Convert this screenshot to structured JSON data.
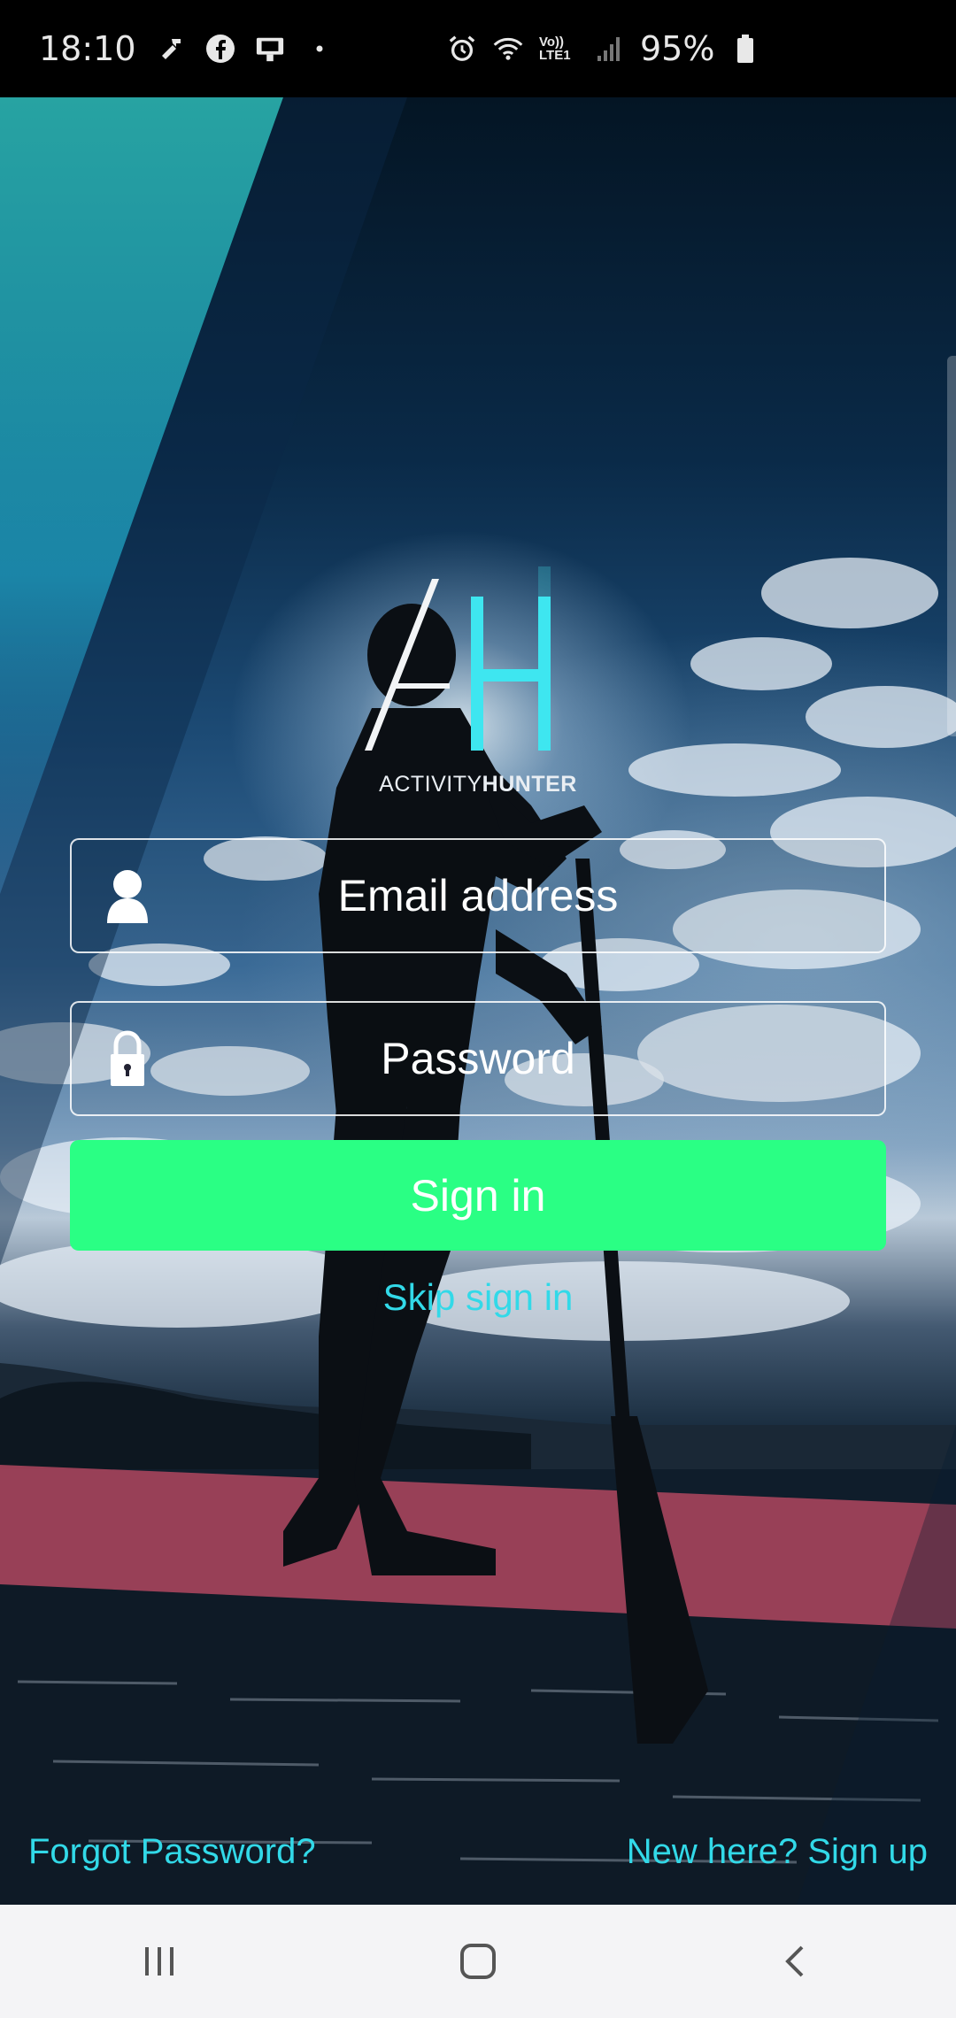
{
  "status_bar": {
    "time": "18:10",
    "battery_text": "95%",
    "left_icons": [
      "tools-icon",
      "facebook-icon",
      "cast-icon",
      "dot-icon"
    ],
    "right_icons": [
      "alarm-icon",
      "wifi-icon",
      "volte-icon",
      "signal-icon",
      "battery-icon"
    ],
    "volte_text": "Vo)) LTE1"
  },
  "logo": {
    "mark": "AH",
    "text_light": "ACTIVITY",
    "text_bold": "HUNTER",
    "accent_color": "#3ee6f0"
  },
  "form": {
    "email_placeholder": "Email address",
    "password_placeholder": "Password",
    "signin_label": "Sign in",
    "signin_color": "#2aff84"
  },
  "links": {
    "skip": "Skip sign in",
    "forgot": "Forgot Password?",
    "signup": "New here? Sign up",
    "link_color": "#32d9e8"
  },
  "nav_bar": {
    "buttons": [
      "recent-apps-icon",
      "home-icon",
      "back-icon"
    ]
  }
}
